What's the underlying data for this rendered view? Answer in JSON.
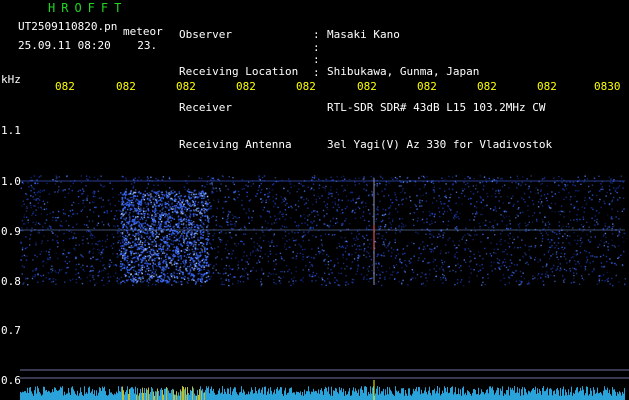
{
  "header": {
    "app_title": "HROFFT",
    "file_name": "UT2509110820.pn",
    "meteor_label": "meteor",
    "date": "25.09.11",
    "time": "08:20",
    "counter": "23.",
    "meta": [
      {
        "key": "Observer",
        "value": "Masaki Kano"
      },
      {
        "key": "Receiving Location",
        "value": "Shibukawa, Gunma, Japan"
      },
      {
        "key": "Receiver",
        "value": "RTL-SDR SDR# 43dB L15 103.2MHz CW"
      },
      {
        "key": "Receiving Antenna",
        "value": "3el Yagi(V) Az 330 for Vladivostok"
      }
    ]
  },
  "axes": {
    "y_unit": "kHz",
    "y_ticks": [
      "1.1",
      "1.0",
      "0.9",
      "0.8",
      "0.7",
      "0.6"
    ],
    "x_ticks": [
      "082",
      "082",
      "082",
      "082",
      "082",
      "082",
      "082",
      "082",
      "082",
      "0830"
    ]
  },
  "colors": {
    "background": "#000000",
    "title": "#22d422",
    "time_ticks": "#ffff00",
    "signal": "#2a5cff",
    "grid_line": "#7070a0"
  }
}
